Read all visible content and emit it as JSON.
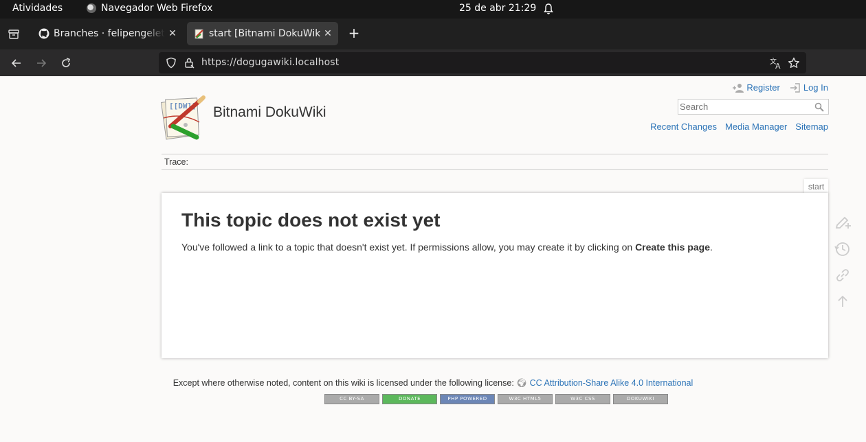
{
  "system_bar": {
    "activities": "Atividades",
    "app_name": "Navegador Web Firefox",
    "clock": "25 de abr  21:29"
  },
  "tabs": [
    {
      "label": "Branches · felipengeletric",
      "icon": "github-icon",
      "active": false
    },
    {
      "label": "start [Bitnami DokuWiki]",
      "icon": "dokuwiki-favicon",
      "active": true
    }
  ],
  "urlbar": {
    "url": "https://dogugawiki.localhost"
  },
  "wiki": {
    "site_title": "Bitnami DokuWiki",
    "user_links": {
      "register": "Register",
      "login": "Log In"
    },
    "search_placeholder": "Search",
    "site_links": {
      "recent_changes": "Recent Changes",
      "media_manager": "Media Manager",
      "sitemap": "Sitemap"
    },
    "trace_label": "Trace:",
    "page_id": "start",
    "heading": "This topic does not exist yet",
    "body_text": "You've followed a link to a topic that doesn't exist yet. If permissions allow, you may create it by clicking on ",
    "body_link": "Create this page",
    "body_end": ".",
    "license_text": "Except where otherwise noted, content on this wiki is licensed under the following license: ",
    "license_link": "CC Attribution-Share Alike 4.0 International",
    "badges": [
      "CC BY-SA",
      "DONATE",
      "PHP POWERED",
      "W3C HTML5",
      "W3C CSS",
      "DOKUWIKI"
    ]
  },
  "colors": {
    "link": "#2b73b7",
    "topbar": "#171717",
    "tabstrip": "#202020",
    "navbar": "#2b2a2b"
  }
}
